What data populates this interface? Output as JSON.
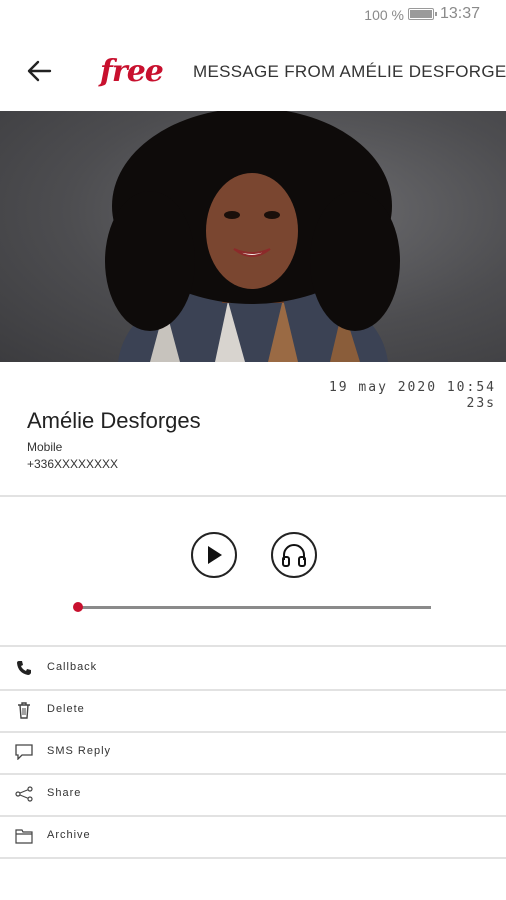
{
  "status_bar": {
    "battery": "100 %",
    "time": "13:37"
  },
  "app_bar": {
    "logo": "free",
    "title": "MESSAGE FROM AMÉLIE DESFORGES"
  },
  "message": {
    "date": "19 may 2020 10:54",
    "duration": "23s",
    "contact_name": "Amélie Desforges",
    "contact_type": "Mobile",
    "contact_number": "+336XXXXXXXX",
    "playback_progress": 0
  },
  "actions": [
    {
      "label": "Callback",
      "icon": "phone-icon"
    },
    {
      "label": "Delete",
      "icon": "trash-icon"
    },
    {
      "label": "SMS Reply",
      "icon": "chat-icon"
    },
    {
      "label": "Share",
      "icon": "share-icon"
    },
    {
      "label": "Archive",
      "icon": "archive-icon"
    }
  ],
  "colors": {
    "accent": "#c8102e",
    "divider": "#e2e2e2"
  }
}
